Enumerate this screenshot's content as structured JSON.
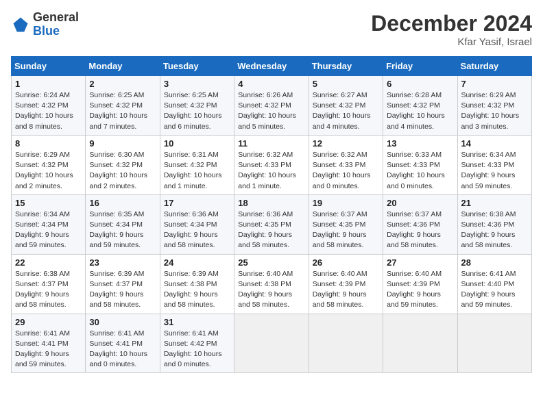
{
  "logo": {
    "general": "General",
    "blue": "Blue"
  },
  "header": {
    "month": "December 2024",
    "location": "Kfar Yasif, Israel"
  },
  "weekdays": [
    "Sunday",
    "Monday",
    "Tuesday",
    "Wednesday",
    "Thursday",
    "Friday",
    "Saturday"
  ],
  "weeks": [
    [
      {
        "day": "1",
        "sunrise": "6:24 AM",
        "sunset": "4:32 PM",
        "daylight": "10 hours and 8 minutes."
      },
      {
        "day": "2",
        "sunrise": "6:25 AM",
        "sunset": "4:32 PM",
        "daylight": "10 hours and 7 minutes."
      },
      {
        "day": "3",
        "sunrise": "6:25 AM",
        "sunset": "4:32 PM",
        "daylight": "10 hours and 6 minutes."
      },
      {
        "day": "4",
        "sunrise": "6:26 AM",
        "sunset": "4:32 PM",
        "daylight": "10 hours and 5 minutes."
      },
      {
        "day": "5",
        "sunrise": "6:27 AM",
        "sunset": "4:32 PM",
        "daylight": "10 hours and 4 minutes."
      },
      {
        "day": "6",
        "sunrise": "6:28 AM",
        "sunset": "4:32 PM",
        "daylight": "10 hours and 4 minutes."
      },
      {
        "day": "7",
        "sunrise": "6:29 AM",
        "sunset": "4:32 PM",
        "daylight": "10 hours and 3 minutes."
      }
    ],
    [
      {
        "day": "8",
        "sunrise": "6:29 AM",
        "sunset": "4:32 PM",
        "daylight": "10 hours and 2 minutes."
      },
      {
        "day": "9",
        "sunrise": "6:30 AM",
        "sunset": "4:32 PM",
        "daylight": "10 hours and 2 minutes."
      },
      {
        "day": "10",
        "sunrise": "6:31 AM",
        "sunset": "4:32 PM",
        "daylight": "10 hours and 1 minute."
      },
      {
        "day": "11",
        "sunrise": "6:32 AM",
        "sunset": "4:33 PM",
        "daylight": "10 hours and 1 minute."
      },
      {
        "day": "12",
        "sunrise": "6:32 AM",
        "sunset": "4:33 PM",
        "daylight": "10 hours and 0 minutes."
      },
      {
        "day": "13",
        "sunrise": "6:33 AM",
        "sunset": "4:33 PM",
        "daylight": "10 hours and 0 minutes."
      },
      {
        "day": "14",
        "sunrise": "6:34 AM",
        "sunset": "4:33 PM",
        "daylight": "9 hours and 59 minutes."
      }
    ],
    [
      {
        "day": "15",
        "sunrise": "6:34 AM",
        "sunset": "4:34 PM",
        "daylight": "9 hours and 59 minutes."
      },
      {
        "day": "16",
        "sunrise": "6:35 AM",
        "sunset": "4:34 PM",
        "daylight": "9 hours and 59 minutes."
      },
      {
        "day": "17",
        "sunrise": "6:36 AM",
        "sunset": "4:34 PM",
        "daylight": "9 hours and 58 minutes."
      },
      {
        "day": "18",
        "sunrise": "6:36 AM",
        "sunset": "4:35 PM",
        "daylight": "9 hours and 58 minutes."
      },
      {
        "day": "19",
        "sunrise": "6:37 AM",
        "sunset": "4:35 PM",
        "daylight": "9 hours and 58 minutes."
      },
      {
        "day": "20",
        "sunrise": "6:37 AM",
        "sunset": "4:36 PM",
        "daylight": "9 hours and 58 minutes."
      },
      {
        "day": "21",
        "sunrise": "6:38 AM",
        "sunset": "4:36 PM",
        "daylight": "9 hours and 58 minutes."
      }
    ],
    [
      {
        "day": "22",
        "sunrise": "6:38 AM",
        "sunset": "4:37 PM",
        "daylight": "9 hours and 58 minutes."
      },
      {
        "day": "23",
        "sunrise": "6:39 AM",
        "sunset": "4:37 PM",
        "daylight": "9 hours and 58 minutes."
      },
      {
        "day": "24",
        "sunrise": "6:39 AM",
        "sunset": "4:38 PM",
        "daylight": "9 hours and 58 minutes."
      },
      {
        "day": "25",
        "sunrise": "6:40 AM",
        "sunset": "4:38 PM",
        "daylight": "9 hours and 58 minutes."
      },
      {
        "day": "26",
        "sunrise": "6:40 AM",
        "sunset": "4:39 PM",
        "daylight": "9 hours and 58 minutes."
      },
      {
        "day": "27",
        "sunrise": "6:40 AM",
        "sunset": "4:39 PM",
        "daylight": "9 hours and 59 minutes."
      },
      {
        "day": "28",
        "sunrise": "6:41 AM",
        "sunset": "4:40 PM",
        "daylight": "9 hours and 59 minutes."
      }
    ],
    [
      {
        "day": "29",
        "sunrise": "6:41 AM",
        "sunset": "4:41 PM",
        "daylight": "9 hours and 59 minutes."
      },
      {
        "day": "30",
        "sunrise": "6:41 AM",
        "sunset": "4:41 PM",
        "daylight": "10 hours and 0 minutes."
      },
      {
        "day": "31",
        "sunrise": "6:41 AM",
        "sunset": "4:42 PM",
        "daylight": "10 hours and 0 minutes."
      },
      null,
      null,
      null,
      null
    ]
  ],
  "labels": {
    "sunrise": "Sunrise:",
    "sunset": "Sunset:",
    "daylight": "Daylight:"
  }
}
